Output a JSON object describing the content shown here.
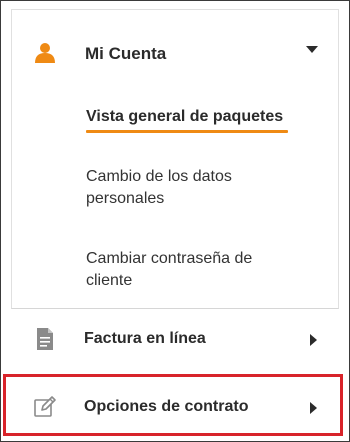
{
  "menu": {
    "account": {
      "label": "Mi Cuenta",
      "icon": "user-icon",
      "icon_color": "#ef8a14",
      "expanded": true
    },
    "submenu": [
      {
        "label": "Vista general de paquetes",
        "active": true
      },
      {
        "label": "Cambio de los datos personales",
        "active": false
      },
      {
        "label": "Cambiar contraseña de cliente",
        "active": false
      }
    ],
    "rows": [
      {
        "label": "Factura en línea",
        "icon": "document-icon"
      },
      {
        "label": "Opciones de contrato",
        "icon": "edit-icon",
        "highlighted": true
      }
    ]
  },
  "colors": {
    "accent": "#ef8a14",
    "highlight_border": "#d8232a",
    "text": "#2b2b2b",
    "icon_gray": "#8a8a8a"
  }
}
